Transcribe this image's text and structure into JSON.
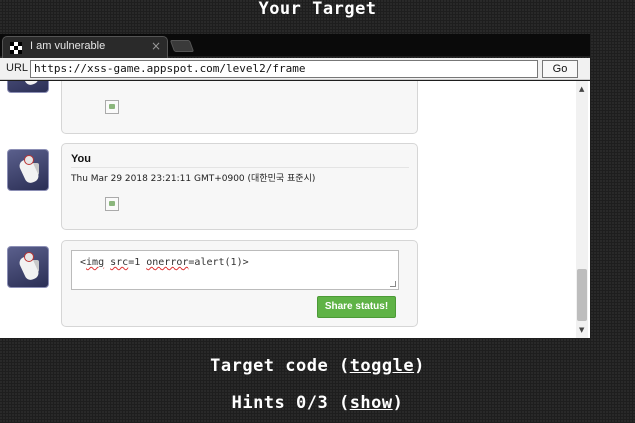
{
  "page": {
    "top_heading": "Your Target",
    "target_code_prefix": "Target code (",
    "target_code_link": "toggle",
    "target_code_suffix": ")",
    "hints_prefix": "Hints 0/3 (",
    "hints_link": "show",
    "hints_suffix": ")"
  },
  "browser": {
    "tab_title": "I am vulnerable",
    "tab_close": "×",
    "url_label": "URL",
    "url_value": "https://xss-game.appspot.com/level2/frame",
    "go_label": "Go"
  },
  "posts": [
    {
      "author": "",
      "date": "",
      "has_image": true
    },
    {
      "author": "You",
      "date": "Thu Mar 29 2018 23:21:11 GMT+0900 (대한민국 표준시)",
      "has_image": true
    }
  ],
  "compose": {
    "text_part1": "<",
    "text_img": "img",
    "text_part2": " ",
    "text_src": "src",
    "text_part3": "=1 ",
    "text_onerror": "onerror",
    "text_part4": "=alert(1)>",
    "share_label": "Share status!"
  },
  "icons": {
    "favicon": "checker-favicon-icon",
    "avatar": "astronaut-avatar-icon",
    "broken_image": "broken-image-icon"
  },
  "colors": {
    "page_bg": "#1e1e1e",
    "share_button": "#5fb346",
    "card_bg": "#f7f7f7"
  }
}
